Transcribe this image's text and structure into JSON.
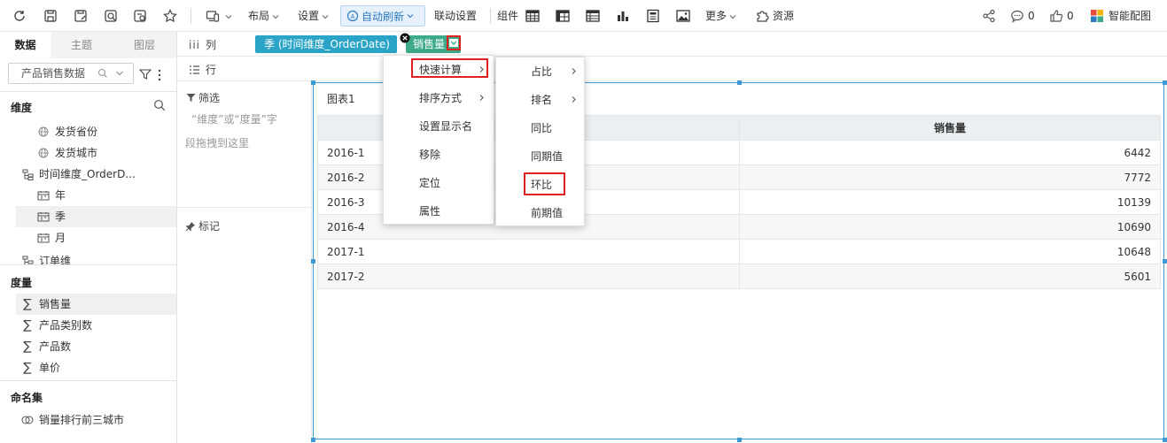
{
  "toolbar": {
    "layout": "布局",
    "settings": "设置",
    "auto_refresh": "自动刷新",
    "linkage": "联动设置",
    "components": "组件",
    "more": "更多",
    "resources": "资源",
    "comments_count": "0",
    "likes_count": "0",
    "smart_color": "智能配图"
  },
  "left_panel": {
    "tabs": [
      "数据",
      "主题",
      "图层"
    ],
    "dataset": "产品销售数据",
    "dimension_title": "维度",
    "dimensions": [
      "发货省份",
      "发货城市",
      "时间维度_OrderD...",
      "年",
      "季",
      "月",
      "订单维"
    ],
    "measure_title": "度量",
    "measures": [
      "销售量",
      "产品类别数",
      "产品数",
      "单价"
    ],
    "named_set_title": "命名集",
    "named_sets": [
      "销量排行前三城市"
    ]
  },
  "shelves": {
    "column_label": "列",
    "row_label": "行",
    "filter_label": "筛选",
    "filter_hint_1": "“维度”或“度量”字",
    "filter_hint_2": "段拖拽到这里",
    "mark_label": "标记",
    "pill_quarter": "季 (时间维度_OrderDate)",
    "pill_sales": "销售量"
  },
  "chart": {
    "title": "图表1",
    "header": [
      "",
      "销售量"
    ],
    "rows": [
      [
        "2016-1",
        "6442"
      ],
      [
        "2016-2",
        "7772"
      ],
      [
        "2016-3",
        "10139"
      ],
      [
        "2016-4",
        "10690"
      ],
      [
        "2017-1",
        "10648"
      ],
      [
        "2017-2",
        "5601"
      ]
    ]
  },
  "menu": {
    "items": [
      "快速计算",
      "排序方式",
      "设置显示名",
      "移除",
      "定位",
      "属性"
    ]
  },
  "submenu": {
    "items": [
      "占比",
      "排名",
      "同比",
      "同期值",
      "环比",
      "前期值"
    ]
  },
  "colors": {
    "pill_quarter": "#2aa4c7",
    "pill_sales": "#3dab8a",
    "highlight": "#e02020",
    "selection": "#3d9ad6"
  }
}
